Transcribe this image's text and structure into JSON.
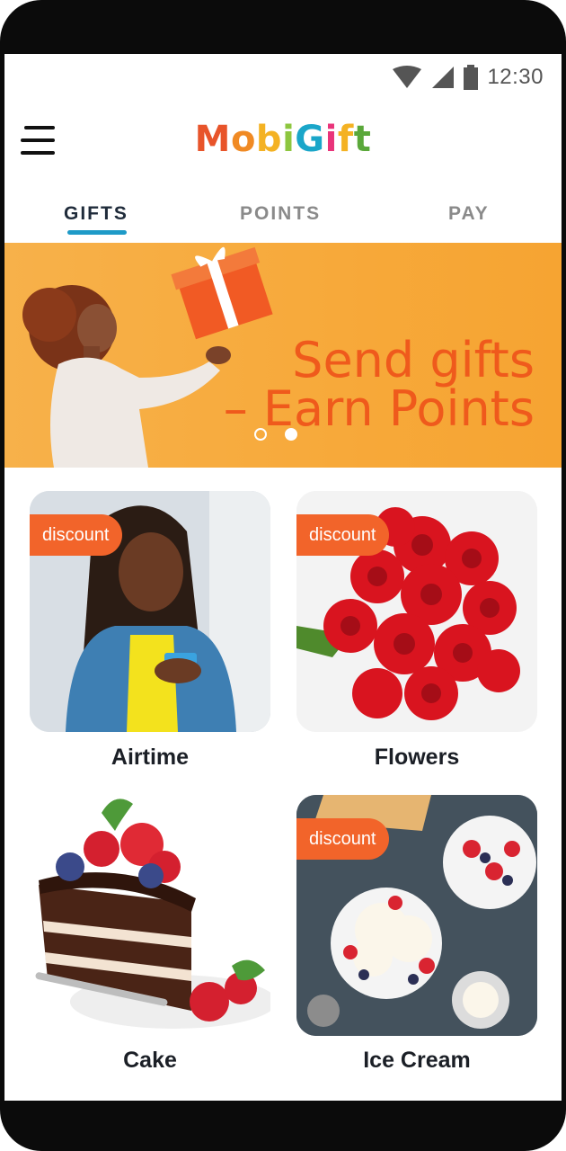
{
  "status_bar": {
    "time": "12:30"
  },
  "header": {
    "logo": {
      "letters": [
        "M",
        "o",
        "b",
        "i",
        "G",
        "i",
        "f",
        "t"
      ],
      "colors": [
        "#e8542a",
        "#f08a24",
        "#f4b223",
        "#8dc63f",
        "#1aa6c9",
        "#e9347a",
        "#f4b223",
        "#5aa83a"
      ]
    }
  },
  "tabs": [
    {
      "label": "GIFTS",
      "active": true
    },
    {
      "label": "POINTS",
      "active": false
    },
    {
      "label": "PAY",
      "active": false
    }
  ],
  "banner": {
    "line1": "Send gifts",
    "line2": "– Earn Points",
    "slides": 2,
    "active_slide": 2
  },
  "categories": [
    {
      "label": "Airtime",
      "badge": "discount"
    },
    {
      "label": "Flowers",
      "badge": "discount"
    },
    {
      "label": "Cake"
    },
    {
      "label": "Ice Cream",
      "badge": "discount"
    }
  ],
  "colors": {
    "accent": "#1e9ac7",
    "badge": "#f2642a",
    "banner_bg": "#f7b14a",
    "banner_text": "#ef5a1c"
  }
}
